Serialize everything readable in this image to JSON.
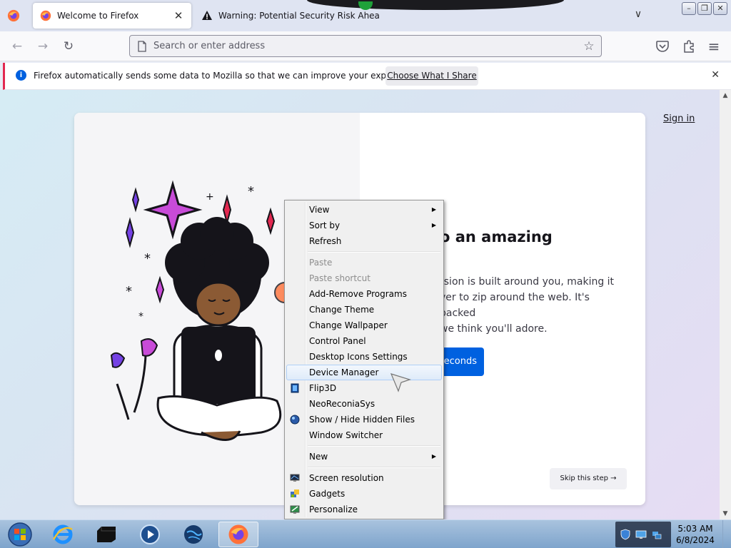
{
  "browser": {
    "tabs": [
      {
        "title": "Welcome to Firefox",
        "active": true
      },
      {
        "title": "Warning: Potential Security Risk Ahead",
        "active": false
      }
    ],
    "window_buttons": {
      "minimize": "–",
      "restore": "❐",
      "close": "✕"
    },
    "tab_close_glyph": "✕",
    "tab_list_glyph": "∨"
  },
  "navbar": {
    "back_glyph": "←",
    "forward_glyph": "→",
    "reload_glyph": "↻",
    "search_placeholder": "Search or enter address",
    "bookmark_glyph": "☆",
    "menu_glyph": "≡"
  },
  "notification": {
    "message": "Firefox automatically sends some data to Mozilla so that we can improve your experience.",
    "button": "Choose What I Share",
    "close_glyph": "✕",
    "info_glyph": "i"
  },
  "page": {
    "sign_in": "Sign in",
    "heading_visible": "o an amazing",
    "body_lines": [
      "rsion is built around you, making it",
      "ver to zip around the web. It's packed",
      " we think you'll adore."
    ],
    "primary_button": "econds",
    "skip_button": "Skip this step →"
  },
  "context_menu": {
    "groups": [
      [
        {
          "label": "View",
          "submenu": true
        },
        {
          "label": "Sort by",
          "submenu": true
        },
        {
          "label": "Refresh"
        }
      ],
      [
        {
          "label": "Paste",
          "disabled": true
        },
        {
          "label": "Paste shortcut",
          "disabled": true
        },
        {
          "label": "Add-Remove Programs"
        },
        {
          "label": "Change Theme"
        },
        {
          "label": "Change Wallpaper"
        },
        {
          "label": "Control Panel"
        },
        {
          "label": "Desktop Icons Settings"
        },
        {
          "label": "Device Manager",
          "hover": true
        },
        {
          "label": "Flip3D",
          "icon": "flip3d-icon"
        },
        {
          "label": "NeoReconiaSys"
        },
        {
          "label": "Show / Hide Hidden Files",
          "icon": "globe-icon"
        },
        {
          "label": "Window Switcher"
        }
      ],
      [
        {
          "label": "New",
          "submenu": true
        }
      ],
      [
        {
          "label": "Screen resolution",
          "icon": "monitor-icon"
        },
        {
          "label": "Gadgets",
          "icon": "gadgets-icon"
        },
        {
          "label": "Personalize",
          "icon": "personalize-icon"
        }
      ]
    ],
    "submenu_glyph": "▶"
  },
  "taskbar": {
    "items": [
      "start-orb-icon",
      "internet-explorer-icon",
      "terminal-icon",
      "media-player-icon",
      "network-globe-icon",
      "firefox-icon"
    ],
    "clock_time": "5:03 AM",
    "clock_date": "6/8/2024"
  },
  "colors": {
    "accent_blue": "#0061e0",
    "notification_stripe": "#e22850",
    "hover_border": "#aecff7"
  }
}
